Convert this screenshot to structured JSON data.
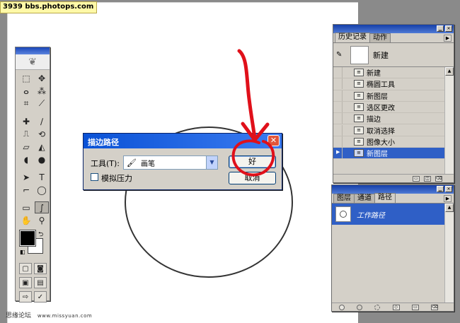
{
  "watermark": {
    "text": "3939   bbs.photops.com"
  },
  "footer_credit": {
    "name": "思缘论坛",
    "url": "www.missyuan.com"
  },
  "toolbox": {
    "tool_icons": [
      "marquee-icon",
      "move-icon",
      "lasso-icon",
      "magic-wand-icon",
      "crop-icon",
      "slice-icon",
      "healing-brush-icon",
      "brush-icon",
      "clone-stamp-icon",
      "history-brush-icon",
      "eraser-icon",
      "paint-bucket-icon",
      "blur-icon",
      "dodge-icon",
      "path-selection-icon",
      "type-icon",
      "pen-icon",
      "ellipse-icon",
      "notes-icon",
      "eyedropper-icon",
      "hand-icon",
      "zoom-icon"
    ],
    "tool_glyphs": [
      "⬚",
      "✥",
      "ⴰ",
      "⁂",
      "⌗",
      "⟋",
      "✚",
      "∕",
      "⎍",
      "⟲",
      "▱",
      "◭",
      "◖",
      "●",
      "➤",
      "T",
      "⌐",
      "◯",
      "▭",
      "∫",
      "✋",
      "⚲"
    ],
    "active_tool_index": 19
  },
  "history_panel": {
    "tabs": [
      "历史记录",
      "动作"
    ],
    "active_tab": 0,
    "snapshot_label": "新建",
    "items": [
      "新建",
      "椭圆工具",
      "新图层",
      "选区更改",
      "描边",
      "取消选择",
      "图像大小",
      "新图层"
    ],
    "selected_index": 7
  },
  "paths_panel": {
    "tabs": [
      "图层",
      "通道",
      "路径"
    ],
    "active_tab": 2,
    "path_name": "工作路径"
  },
  "stroke_dialog": {
    "title": "描边路径",
    "tool_label": "工具(T):",
    "tool_value": "画笔",
    "simulate_pressure_label": "模拟压力",
    "simulate_pressure_checked": false,
    "ok_label": "好",
    "cancel_label": "取消"
  },
  "colors": {
    "accent": "#2f5fc6",
    "dialog_title": "#0a52d6",
    "annotation": "#e0101a"
  }
}
